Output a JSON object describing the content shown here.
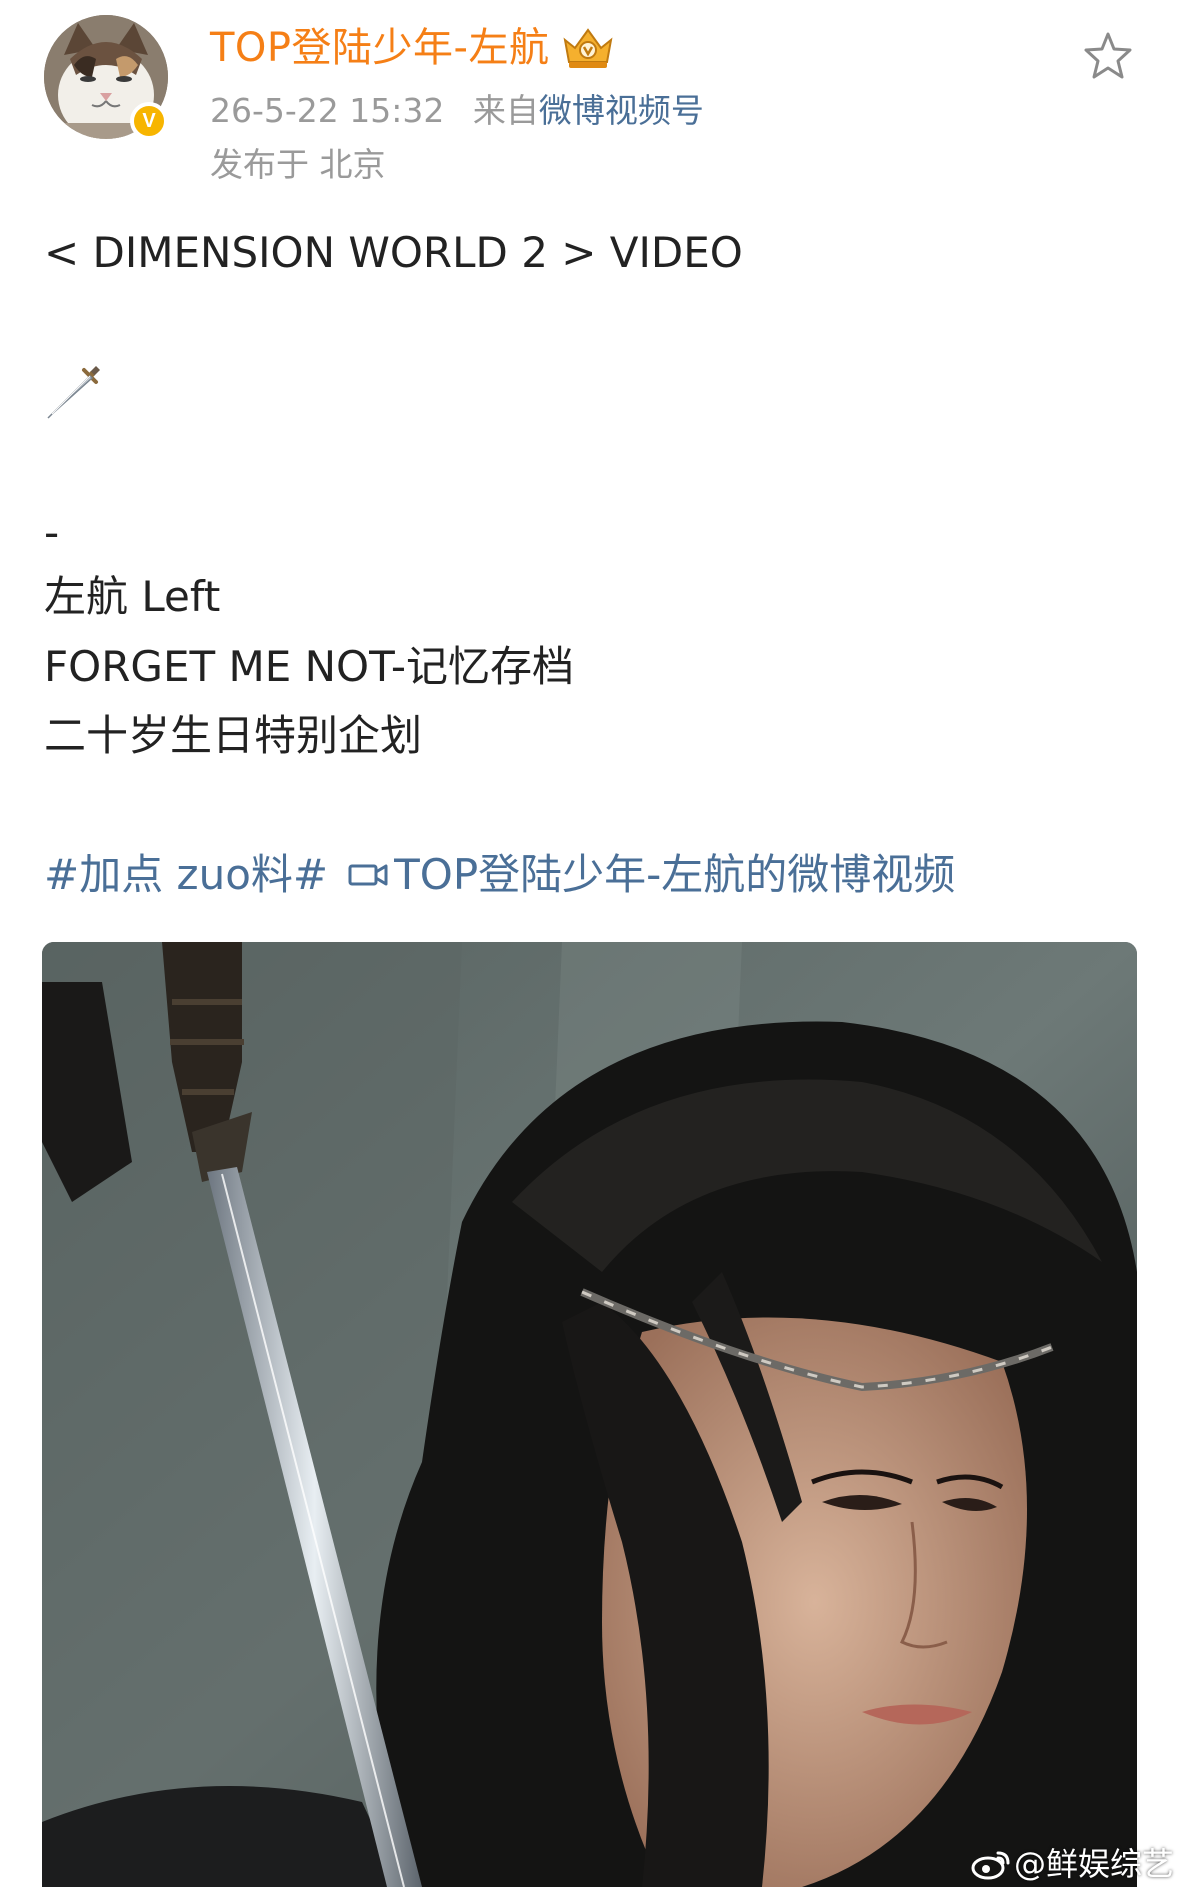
{
  "header": {
    "username": "TOP登陆少年-左航",
    "timestamp": "26-5-22 15:32",
    "source_prefix": "来自",
    "source_name": "微博视频号",
    "location": "发布于 北京",
    "verified_badge_letter": "V"
  },
  "post": {
    "line_dimension": "< DIMENSION WORLD 2 > VIDEO",
    "line_dash": "-",
    "line_name": "左航 Left",
    "line_forget": "FORGET ME NOT-记忆存档",
    "line_birthday": "二十岁生日特别企划",
    "hashtag": "#加点 zuo料#",
    "video_link": "TOP登陆少年-左航的微博视频"
  },
  "watermark": {
    "text": "@鲜娱综艺"
  },
  "icons": {
    "favorite": "star-icon",
    "emoji": "dagger-icon",
    "membership": "vip-crown-icon",
    "video_link": "video-camera-icon",
    "watermark": "weibo-logo-icon"
  },
  "colors": {
    "username": "#f57f16",
    "link": "#4a6f97",
    "meta": "#9a9a9a",
    "text": "#222222",
    "verified": "#f7b500"
  }
}
